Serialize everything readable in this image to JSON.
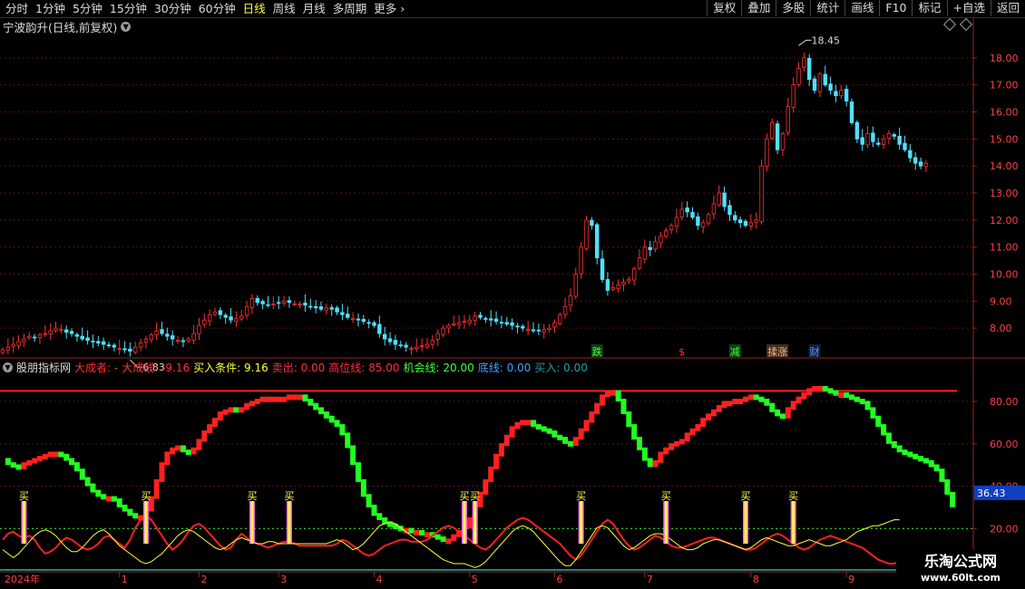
{
  "toolbar": {
    "periods": [
      "分时",
      "1分钟",
      "5分钟",
      "15分钟",
      "30分钟",
      "60分钟",
      "日线",
      "周线",
      "月线",
      "多周期",
      "更多"
    ],
    "active_period": "日线",
    "more_icon": "chevron-right-icon",
    "tools": [
      "复权",
      "叠加",
      "多股",
      "统计",
      "画线",
      "F10",
      "标记",
      "+自选",
      "返回"
    ]
  },
  "stock": {
    "title": "宁波韵升(日线,前复权)"
  },
  "indicator": {
    "name": "股朋指标网",
    "items": [
      {
        "text": "大成者: -",
        "color": "#ff3030"
      },
      {
        "text": "大成线: -9.16",
        "color": "#ff3030"
      },
      {
        "text": "买入条件: 9.16",
        "color": "#ffff40"
      },
      {
        "text": "卖出: 0.00",
        "color": "#ff3030"
      },
      {
        "text": "高位线: 85.00",
        "color": "#ff3030"
      },
      {
        "text": "机会线: 20.00",
        "color": "#40ff40"
      },
      {
        "text": "底线: 0.00",
        "color": "#40a0ff"
      },
      {
        "text": "买入: 0.00",
        "color": "#20a0a0"
      }
    ],
    "current_value": "36.43"
  },
  "events": [
    {
      "label": "跌",
      "color": "#40ff40",
      "bg": "#104010",
      "index": 112
    },
    {
      "label": "$",
      "color": "#ff3030",
      "bg": "#000000",
      "index": 128
    },
    {
      "label": "减",
      "color": "#40ff40",
      "bg": "#104010",
      "index": 138
    },
    {
      "label": "揉涨",
      "color": "#ffb080",
      "bg": "#403020",
      "index": 146
    },
    {
      "label": "财",
      "color": "#40a0ff",
      "bg": "#102040",
      "index": 153
    }
  ],
  "buy_signal_label": "买",
  "x_axis": [
    {
      "label": "2024年",
      "index": 0
    },
    {
      "label": "1",
      "index": 22
    },
    {
      "label": "2",
      "index": 37
    },
    {
      "label": "3",
      "index": 52
    },
    {
      "label": "4",
      "index": 70
    },
    {
      "label": "5",
      "index": 88
    },
    {
      "label": "6",
      "index": 104
    },
    {
      "label": "7",
      "index": 121
    },
    {
      "label": "8",
      "index": 141
    },
    {
      "label": "9",
      "index": 159
    }
  ],
  "watermark": {
    "name": "乐淘公式网",
    "url": "www.60lt.com"
  },
  "colors": {
    "up": "#ff3030",
    "down": "#50e0ff",
    "ind_up": "#ff2020",
    "ind_down": "#20ff20"
  },
  "chart_data": [
    {
      "type": "candlestick",
      "ylim": [
        7.0,
        19.0
      ],
      "yticks": [
        8,
        9,
        10,
        11,
        12,
        13,
        14,
        15,
        16,
        17,
        18
      ],
      "annotations": [
        {
          "text": "6.83",
          "index": 24,
          "value": 6.83
        },
        {
          "text": "18.45",
          "index": 150,
          "value": 18.45
        }
      ],
      "closes": [
        7.2,
        7.3,
        7.4,
        7.5,
        7.6,
        7.7,
        7.65,
        7.75,
        7.8,
        7.9,
        8.0,
        7.95,
        7.85,
        7.8,
        7.7,
        7.6,
        7.55,
        7.5,
        7.45,
        7.4,
        7.35,
        7.3,
        7.25,
        7.2,
        7.15,
        7.3,
        7.45,
        7.6,
        7.75,
        7.9,
        7.8,
        7.7,
        7.6,
        7.55,
        7.5,
        7.6,
        7.8,
        8.1,
        8.3,
        8.5,
        8.6,
        8.5,
        8.4,
        8.3,
        8.35,
        8.45,
        8.8,
        9.1,
        8.95,
        8.9,
        8.85,
        8.9,
        8.95,
        9.0,
        8.95,
        8.9,
        8.9,
        8.85,
        8.8,
        8.75,
        8.7,
        8.75,
        8.7,
        8.6,
        8.5,
        8.4,
        8.35,
        8.3,
        8.25,
        8.2,
        8.1,
        7.8,
        7.6,
        7.5,
        7.4,
        7.35,
        7.3,
        7.25,
        7.3,
        7.35,
        7.4,
        7.55,
        7.8,
        8.0,
        8.1,
        8.15,
        8.2,
        8.25,
        8.3,
        8.45,
        8.4,
        8.35,
        8.3,
        8.25,
        8.2,
        8.15,
        8.1,
        8.05,
        8.0,
        7.95,
        7.9,
        7.9,
        7.95,
        8.0,
        8.2,
        8.5,
        8.8,
        9.2,
        10.0,
        11.0,
        12.0,
        11.8,
        10.6,
        9.8,
        9.4,
        9.5,
        9.6,
        9.7,
        9.8,
        10.2,
        10.6,
        11.0,
        10.9,
        11.2,
        11.4,
        11.6,
        11.8,
        12.1,
        12.4,
        12.3,
        12.1,
        11.8,
        11.9,
        12.2,
        12.6,
        13.0,
        12.5,
        12.2,
        12.0,
        11.9,
        11.8,
        11.9,
        12.0,
        14.0,
        15.0,
        15.6,
        14.6,
        15.2,
        16.2,
        17.0,
        17.6,
        18.0,
        17.2,
        16.8,
        17.4,
        17.0,
        16.8,
        16.6,
        16.8,
        16.4,
        15.6,
        15.0,
        14.8,
        15.2,
        14.9,
        14.8,
        15.0,
        15.2,
        15.1,
        14.8,
        14.6,
        14.3,
        14.1,
        14.0,
        14.1
      ]
    },
    {
      "type": "indicator-step",
      "ylim": [
        0,
        95
      ],
      "yticks": [
        20,
        40,
        60,
        80
      ],
      "high_line": 85,
      "chance_line": 20,
      "values": [
        52,
        50,
        49,
        48,
        50,
        51,
        52,
        53,
        54,
        55,
        55,
        54,
        52,
        50,
        47,
        43,
        40,
        37,
        35,
        34,
        34,
        33,
        30,
        28,
        26,
        25,
        25,
        28,
        34,
        42,
        50,
        55,
        57,
        58,
        56,
        55,
        57,
        61,
        65,
        68,
        71,
        74,
        75,
        76,
        75,
        76,
        78,
        79,
        80,
        81,
        81,
        81,
        81,
        81,
        82,
        82,
        82,
        80,
        78,
        76,
        74,
        72,
        70,
        68,
        64,
        58,
        50,
        42,
        35,
        30,
        26,
        24,
        22,
        21,
        20,
        19,
        19,
        18,
        18,
        17,
        17,
        16,
        15,
        14,
        14,
        16,
        18,
        20,
        24,
        30,
        36,
        42,
        48,
        54,
        59,
        63,
        67,
        69,
        70,
        70,
        68,
        67,
        66,
        65,
        63,
        62,
        60,
        59,
        62,
        66,
        70,
        74,
        78,
        82,
        84,
        84,
        80,
        74,
        68,
        62,
        57,
        52,
        49,
        51,
        55,
        57,
        59,
        60,
        61,
        64,
        66,
        68,
        71,
        73,
        75,
        77,
        79,
        79,
        80,
        80,
        81,
        82,
        81,
        80,
        78,
        75,
        73,
        72,
        76,
        79,
        81,
        83,
        85,
        86,
        86,
        85,
        84,
        83,
        83,
        82,
        81,
        80,
        79,
        76,
        72,
        68,
        64,
        60,
        58,
        56,
        55,
        54,
        53,
        52,
        51,
        49,
        47,
        42,
        36,
        30
      ]
    },
    {
      "type": "lines",
      "series": [
        {
          "name": "",
          "color": "#ff2020",
          "values": [
            2,
            5,
            6,
            4,
            3,
            4,
            2,
            -2,
            -5,
            -4,
            -2,
            1,
            3,
            2,
            0,
            -2,
            -3,
            -2,
            0,
            3,
            4,
            2,
            0,
            -2,
            2,
            8,
            12,
            14,
            12,
            8,
            4,
            0,
            -3,
            -1,
            2,
            6,
            9,
            10,
            8,
            5,
            2,
            -1,
            -3,
            -2,
            2,
            5,
            3,
            1,
            0,
            -1,
            -2,
            -1,
            0,
            1,
            1,
            0,
            -1,
            -1,
            -1,
            -1,
            -1,
            -1,
            -1,
            0,
            2,
            1,
            -1,
            -3,
            -5,
            -6,
            -5,
            -3,
            -1,
            0,
            1,
            2,
            2,
            1,
            1,
            1,
            2,
            4,
            6,
            8,
            9,
            8,
            6,
            4,
            2,
            0,
            -2,
            -3,
            -1,
            2,
            5,
            8,
            10,
            12,
            13,
            12,
            10,
            8,
            6,
            4,
            2,
            0,
            -3,
            -6,
            -8,
            -6,
            -2,
            2,
            6,
            10,
            12,
            10,
            6,
            2,
            -1,
            -3,
            -2,
            0,
            2,
            4,
            3,
            1,
            -1,
            -2,
            -2,
            -1,
            0,
            1,
            2,
            3,
            3,
            2,
            1,
            0,
            -1,
            -2,
            -3,
            -3,
            -2,
            0,
            2,
            4,
            5,
            4,
            2,
            0,
            -2,
            -3,
            -2,
            0,
            2,
            3,
            4,
            3,
            2,
            1,
            0,
            -1,
            -2,
            -4,
            -6,
            -8,
            -9,
            -10,
            -10,
            -9,
            -8
          ]
        },
        {
          "name": "",
          "color": "#ffff40",
          "values": [
            -3,
            -5,
            -7,
            -5,
            -2,
            1,
            4,
            6,
            7,
            6,
            4,
            1,
            -2,
            -4,
            -4,
            -2,
            1,
            4,
            6,
            7,
            5,
            2,
            -1,
            -3,
            -5,
            -7,
            -9,
            -10,
            -9,
            -7,
            -5,
            -2,
            1,
            4,
            6,
            7,
            6,
            4,
            2,
            0,
            -2,
            -3,
            -2,
            0,
            2,
            3,
            2,
            1,
            0,
            0,
            1,
            1,
            0,
            0,
            0,
            0,
            0,
            0,
            0,
            0,
            0,
            0,
            1,
            2,
            1,
            -1,
            -3,
            -2,
            0,
            3,
            6,
            9,
            10,
            11,
            10,
            8,
            6,
            4,
            2,
            0,
            -2,
            -4,
            -6,
            -8,
            -9,
            -10,
            -10,
            -10,
            -11,
            -12,
            -11,
            -9,
            -6,
            -3,
            0,
            3,
            6,
            8,
            9,
            8,
            6,
            3,
            0,
            -3,
            -6,
            -9,
            -11,
            -11,
            -8,
            -4,
            0,
            4,
            8,
            9,
            8,
            5,
            2,
            -1,
            -3,
            -2,
            0,
            2,
            4,
            5,
            5,
            4,
            2,
            0,
            -2,
            -3,
            -3,
            -2,
            0,
            1,
            2,
            2,
            1,
            0,
            -1,
            -2,
            -3,
            -2,
            0,
            2,
            3,
            2,
            1,
            0,
            -1,
            -1,
            0,
            1,
            2,
            1,
            0,
            -1,
            -1,
            0,
            1,
            2,
            4,
            6,
            7,
            8,
            9,
            9,
            10,
            11,
            12,
            12
          ]
        }
      ]
    }
  ]
}
